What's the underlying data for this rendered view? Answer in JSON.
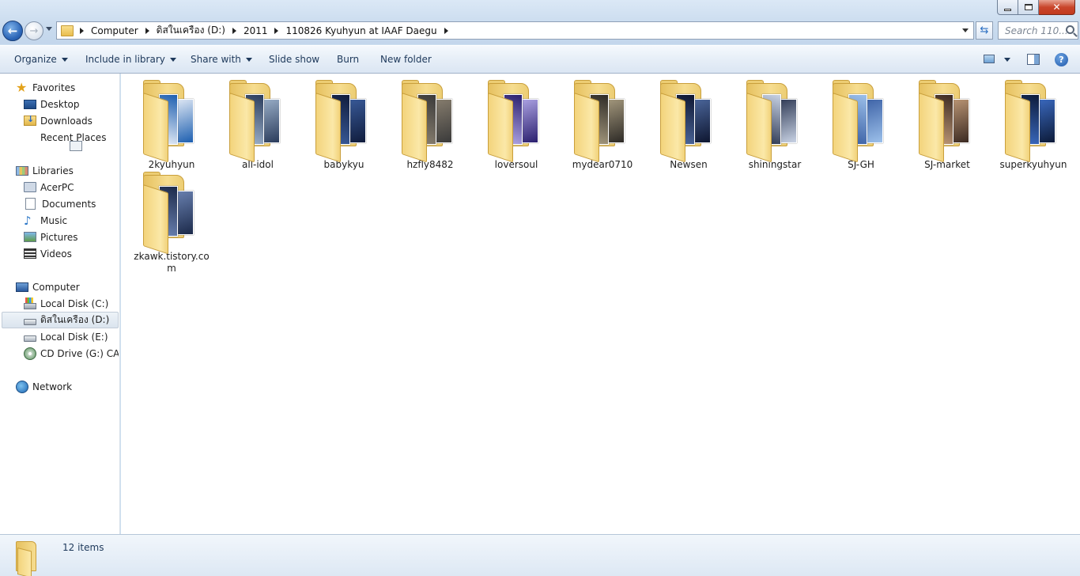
{
  "address": {
    "crumbs": [
      "Computer",
      "ดิสในเครือง (D:)",
      "2011",
      "110826 Kyuhyun at IAAF Daegu"
    ]
  },
  "search": {
    "placeholder": "Search 110..."
  },
  "toolbar": {
    "organize": "Organize",
    "include_in_library": "Include in library",
    "share_with": "Share with",
    "slide_show": "Slide show",
    "burn": "Burn",
    "new_folder": "New folder",
    "help": "?"
  },
  "nav": {
    "favorites": "Favorites",
    "desktop": "Desktop",
    "downloads": "Downloads",
    "recent_places": "Recent Places",
    "libraries": "Libraries",
    "acerpc": "AcerPC",
    "documents": "Documents",
    "music": "Music",
    "pictures": "Pictures",
    "videos": "Videos",
    "computer": "Computer",
    "local_c": "Local Disk (C:)",
    "disk_d": "ดิสในเครือง (D:)",
    "local_e": "Local Disk (E:)",
    "cd_drive": "CD Drive (G:) CAT (",
    "network": "Network"
  },
  "folders": [
    {
      "name": "2kyuhyun",
      "photo": [
        "#1d5fb0",
        "#e8eef7"
      ]
    },
    {
      "name": "all-idol",
      "photo": [
        "#2a3c5c",
        "#9eb3cc"
      ]
    },
    {
      "name": "babykyu",
      "photo": [
        "#101c3c",
        "#3a5c9c"
      ]
    },
    {
      "name": "hzfly8482",
      "photo": [
        "#3a3a3a",
        "#8a8070"
      ]
    },
    {
      "name": "loversoul",
      "photo": [
        "#2a1f6e",
        "#b2a8e8"
      ]
    },
    {
      "name": "mydear0710",
      "photo": [
        "#2d2a26",
        "#a89c80"
      ]
    },
    {
      "name": "Newsen",
      "photo": [
        "#0e1630",
        "#4e6aa0"
      ]
    },
    {
      "name": "shiningstar",
      "photo": [
        "#c8d2e4",
        "#2a3550"
      ]
    },
    {
      "name": "SJ-GH",
      "photo": [
        "#9cc0ea",
        "#3a5fa4"
      ]
    },
    {
      "name": "SJ-market",
      "photo": [
        "#3b2a22",
        "#c09a78"
      ]
    },
    {
      "name": "superkyuhyun",
      "photo": [
        "#0c1a38",
        "#3c6cc4"
      ]
    },
    {
      "name": "zkawk.tistory.com",
      "photo": [
        "#1c2a4a",
        "#6c84b4"
      ]
    }
  ],
  "status": {
    "count": "12 items"
  }
}
